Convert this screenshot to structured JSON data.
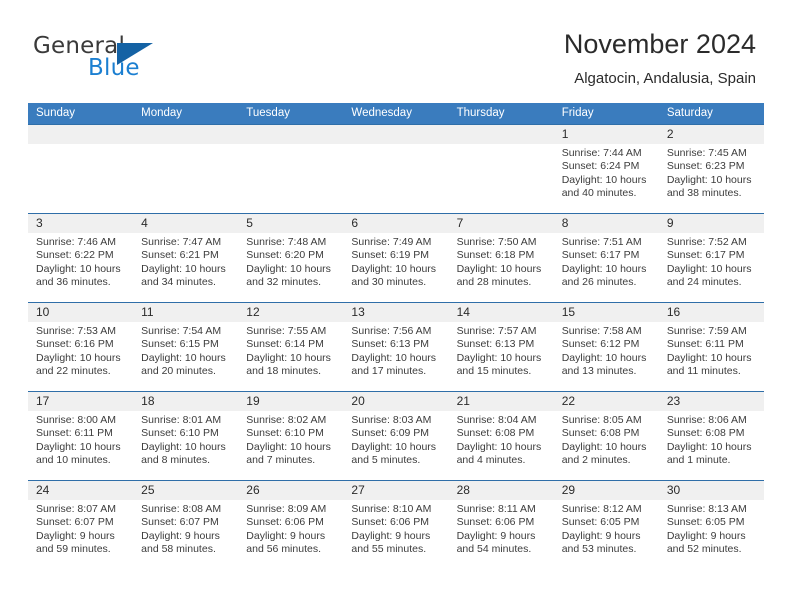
{
  "brand": {
    "name_part1": "General",
    "name_part2": "Blue",
    "logo_icon": "triangle-icon",
    "accent_color": "#1b7fd1",
    "header_color": "#3a7cbe"
  },
  "header": {
    "title": "November 2024",
    "subtitle": "Algatocin, Andalusia, Spain"
  },
  "weekdays": [
    "Sunday",
    "Monday",
    "Tuesday",
    "Wednesday",
    "Thursday",
    "Friday",
    "Saturday"
  ],
  "weeks": [
    [
      {
        "day": "",
        "sunrise": "",
        "sunset": "",
        "daylight": "",
        "empty": true
      },
      {
        "day": "",
        "sunrise": "",
        "sunset": "",
        "daylight": "",
        "empty": true
      },
      {
        "day": "",
        "sunrise": "",
        "sunset": "",
        "daylight": "",
        "empty": true
      },
      {
        "day": "",
        "sunrise": "",
        "sunset": "",
        "daylight": "",
        "empty": true
      },
      {
        "day": "",
        "sunrise": "",
        "sunset": "",
        "daylight": "",
        "empty": true
      },
      {
        "day": "1",
        "sunrise": "Sunrise: 7:44 AM",
        "sunset": "Sunset: 6:24 PM",
        "daylight": "Daylight: 10 hours and 40 minutes."
      },
      {
        "day": "2",
        "sunrise": "Sunrise: 7:45 AM",
        "sunset": "Sunset: 6:23 PM",
        "daylight": "Daylight: 10 hours and 38 minutes."
      }
    ],
    [
      {
        "day": "3",
        "sunrise": "Sunrise: 7:46 AM",
        "sunset": "Sunset: 6:22 PM",
        "daylight": "Daylight: 10 hours and 36 minutes."
      },
      {
        "day": "4",
        "sunrise": "Sunrise: 7:47 AM",
        "sunset": "Sunset: 6:21 PM",
        "daylight": "Daylight: 10 hours and 34 minutes."
      },
      {
        "day": "5",
        "sunrise": "Sunrise: 7:48 AM",
        "sunset": "Sunset: 6:20 PM",
        "daylight": "Daylight: 10 hours and 32 minutes."
      },
      {
        "day": "6",
        "sunrise": "Sunrise: 7:49 AM",
        "sunset": "Sunset: 6:19 PM",
        "daylight": "Daylight: 10 hours and 30 minutes."
      },
      {
        "day": "7",
        "sunrise": "Sunrise: 7:50 AM",
        "sunset": "Sunset: 6:18 PM",
        "daylight": "Daylight: 10 hours and 28 minutes."
      },
      {
        "day": "8",
        "sunrise": "Sunrise: 7:51 AM",
        "sunset": "Sunset: 6:17 PM",
        "daylight": "Daylight: 10 hours and 26 minutes."
      },
      {
        "day": "9",
        "sunrise": "Sunrise: 7:52 AM",
        "sunset": "Sunset: 6:17 PM",
        "daylight": "Daylight: 10 hours and 24 minutes."
      }
    ],
    [
      {
        "day": "10",
        "sunrise": "Sunrise: 7:53 AM",
        "sunset": "Sunset: 6:16 PM",
        "daylight": "Daylight: 10 hours and 22 minutes."
      },
      {
        "day": "11",
        "sunrise": "Sunrise: 7:54 AM",
        "sunset": "Sunset: 6:15 PM",
        "daylight": "Daylight: 10 hours and 20 minutes."
      },
      {
        "day": "12",
        "sunrise": "Sunrise: 7:55 AM",
        "sunset": "Sunset: 6:14 PM",
        "daylight": "Daylight: 10 hours and 18 minutes."
      },
      {
        "day": "13",
        "sunrise": "Sunrise: 7:56 AM",
        "sunset": "Sunset: 6:13 PM",
        "daylight": "Daylight: 10 hours and 17 minutes."
      },
      {
        "day": "14",
        "sunrise": "Sunrise: 7:57 AM",
        "sunset": "Sunset: 6:13 PM",
        "daylight": "Daylight: 10 hours and 15 minutes."
      },
      {
        "day": "15",
        "sunrise": "Sunrise: 7:58 AM",
        "sunset": "Sunset: 6:12 PM",
        "daylight": "Daylight: 10 hours and 13 minutes."
      },
      {
        "day": "16",
        "sunrise": "Sunrise: 7:59 AM",
        "sunset": "Sunset: 6:11 PM",
        "daylight": "Daylight: 10 hours and 11 minutes."
      }
    ],
    [
      {
        "day": "17",
        "sunrise": "Sunrise: 8:00 AM",
        "sunset": "Sunset: 6:11 PM",
        "daylight": "Daylight: 10 hours and 10 minutes."
      },
      {
        "day": "18",
        "sunrise": "Sunrise: 8:01 AM",
        "sunset": "Sunset: 6:10 PM",
        "daylight": "Daylight: 10 hours and 8 minutes."
      },
      {
        "day": "19",
        "sunrise": "Sunrise: 8:02 AM",
        "sunset": "Sunset: 6:10 PM",
        "daylight": "Daylight: 10 hours and 7 minutes."
      },
      {
        "day": "20",
        "sunrise": "Sunrise: 8:03 AM",
        "sunset": "Sunset: 6:09 PM",
        "daylight": "Daylight: 10 hours and 5 minutes."
      },
      {
        "day": "21",
        "sunrise": "Sunrise: 8:04 AM",
        "sunset": "Sunset: 6:08 PM",
        "daylight": "Daylight: 10 hours and 4 minutes."
      },
      {
        "day": "22",
        "sunrise": "Sunrise: 8:05 AM",
        "sunset": "Sunset: 6:08 PM",
        "daylight": "Daylight: 10 hours and 2 minutes."
      },
      {
        "day": "23",
        "sunrise": "Sunrise: 8:06 AM",
        "sunset": "Sunset: 6:08 PM",
        "daylight": "Daylight: 10 hours and 1 minute."
      }
    ],
    [
      {
        "day": "24",
        "sunrise": "Sunrise: 8:07 AM",
        "sunset": "Sunset: 6:07 PM",
        "daylight": "Daylight: 9 hours and 59 minutes."
      },
      {
        "day": "25",
        "sunrise": "Sunrise: 8:08 AM",
        "sunset": "Sunset: 6:07 PM",
        "daylight": "Daylight: 9 hours and 58 minutes."
      },
      {
        "day": "26",
        "sunrise": "Sunrise: 8:09 AM",
        "sunset": "Sunset: 6:06 PM",
        "daylight": "Daylight: 9 hours and 56 minutes."
      },
      {
        "day": "27",
        "sunrise": "Sunrise: 8:10 AM",
        "sunset": "Sunset: 6:06 PM",
        "daylight": "Daylight: 9 hours and 55 minutes."
      },
      {
        "day": "28",
        "sunrise": "Sunrise: 8:11 AM",
        "sunset": "Sunset: 6:06 PM",
        "daylight": "Daylight: 9 hours and 54 minutes."
      },
      {
        "day": "29",
        "sunrise": "Sunrise: 8:12 AM",
        "sunset": "Sunset: 6:05 PM",
        "daylight": "Daylight: 9 hours and 53 minutes."
      },
      {
        "day": "30",
        "sunrise": "Sunrise: 8:13 AM",
        "sunset": "Sunset: 6:05 PM",
        "daylight": "Daylight: 9 hours and 52 minutes."
      }
    ]
  ]
}
